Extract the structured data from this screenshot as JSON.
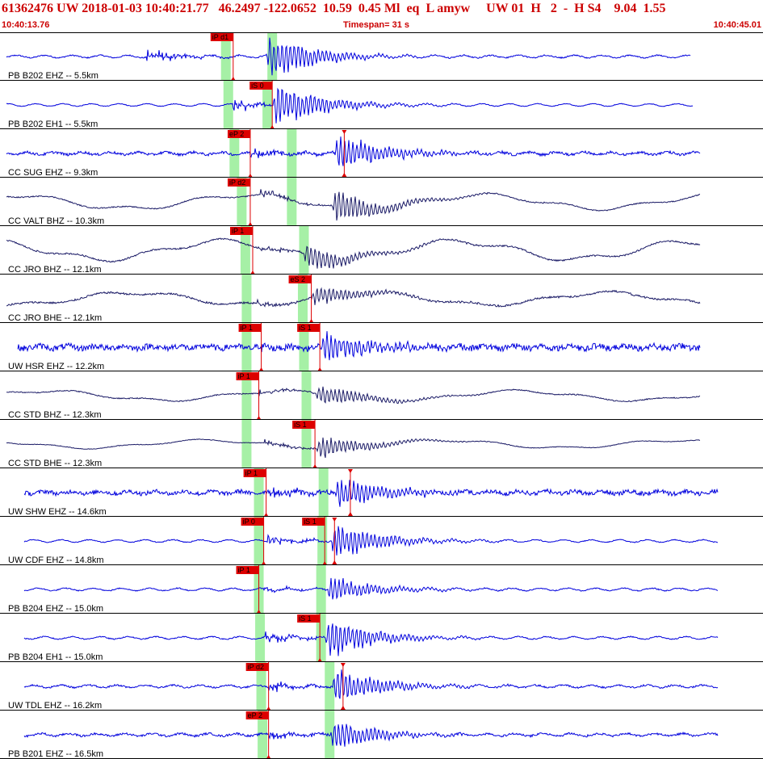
{
  "header": {
    "title": "61362476 UW 2018-01-03 10:40:21.77   46.2497 -122.0652  10.59  0.45 Ml  eq  L amyw     UW 01  H   2  -  H S4    9.04  1.55",
    "start_time": "10:40:13.76",
    "timespan": "Timespan=  31 s",
    "end_time": "10:40:45.01"
  },
  "colors": {
    "panel_border": "#000000",
    "trace_blue": "#0000dd",
    "trace_navy": "#1a1a66",
    "pick_red": "#dd0000",
    "window_green": "#a6f0a6",
    "header_red": "#cc0000"
  },
  "chart_data": {
    "type": "line",
    "x_range_s": [
      0,
      31.25
    ],
    "start_time": "10:40:13.76",
    "end_time": "10:40:45.01",
    "traces": [
      {
        "label": "PB B202 EHZ -- 5.5km",
        "color": "blue",
        "noise": 0.06,
        "lowfreq": 0.0,
        "p_time": 6.0,
        "s_time": 10.9,
        "amp": 1.0,
        "end": 28.3,
        "picks": [
          {
            "label": "iP d1",
            "t": 9.55
          }
        ],
        "green": [
          9.25,
          11.15
        ],
        "extra_marks": []
      },
      {
        "label": "PB B202 EH1 -- 5.5km",
        "color": "blue",
        "noise": 0.03,
        "lowfreq": 0.0,
        "p_time": 9.55,
        "s_time": 11.15,
        "amp": 1.0,
        "end": 28.4,
        "picks": [
          {
            "label": "iS 0",
            "t": 11.15
          }
        ],
        "green": [
          9.35,
          10.95
        ],
        "extra_marks": []
      },
      {
        "label": "CC SUG EHZ -- 9.3km",
        "color": "blue",
        "noise": 0.12,
        "lowfreq": 0.0,
        "p_time": 10.25,
        "s_time": 13.7,
        "amp": 0.9,
        "end": 28.7,
        "picks": [
          {
            "label": "eP 2",
            "t": 10.25
          }
        ],
        "green": [
          9.6,
          11.95
        ],
        "extra_marks": [
          14.1
        ]
      },
      {
        "label": "CC VALT BHZ -- 10.3km",
        "color": "navy",
        "noise": 0.05,
        "lowfreq": 0.32,
        "p_time": 10.65,
        "s_time": 13.6,
        "amp": 0.8,
        "end": 28.7,
        "picks": [
          {
            "label": "iP d2",
            "t": 10.25
          }
        ],
        "green": [
          9.9,
          11.95
        ],
        "extra_marks": []
      },
      {
        "label": "CC JRO BHZ -- 12.1km",
        "color": "navy",
        "noise": 0.07,
        "lowfreq": 0.42,
        "p_time": 10.5,
        "s_time": 12.4,
        "amp": 0.6,
        "end": 28.7,
        "picks": [
          {
            "label": "iP 1",
            "t": 10.35
          }
        ],
        "green": [
          10.05,
          12.45
        ],
        "extra_marks": []
      },
      {
        "label": "CC JRO BHE -- 12.1km",
        "color": "navy",
        "noise": 0.09,
        "lowfreq": 0.28,
        "p_time": 10.5,
        "s_time": 12.75,
        "amp": 0.45,
        "end": 28.7,
        "picks": [
          {
            "label": "eS 2",
            "t": 12.75
          }
        ],
        "green": [
          10.1,
          12.4
        ],
        "extra_marks": []
      },
      {
        "label": "UW HSR EHZ -- 12.2km",
        "color": "blue",
        "noise": 0.28,
        "lowfreq": 0.0,
        "p_time": 10.7,
        "s_time": 13.1,
        "amp": 0.75,
        "end": 28.7,
        "picks": [
          {
            "label": "iP 1",
            "t": 10.7
          },
          {
            "label": "iS 1",
            "t": 13.1
          }
        ],
        "green": [
          10.1,
          12.45
        ],
        "extra_marks": []
      },
      {
        "label": "CC STD BHZ -- 12.3km",
        "color": "navy",
        "noise": 0.05,
        "lowfreq": 0.22,
        "p_time": 10.6,
        "s_time": 12.9,
        "amp": 0.5,
        "end": 28.7,
        "picks": [
          {
            "label": "iP 1",
            "t": 10.6
          }
        ],
        "green": [
          10.1,
          12.55
        ],
        "extra_marks": []
      },
      {
        "label": "CC STD BHE -- 12.3km",
        "color": "navy",
        "noise": 0.03,
        "lowfreq": 0.18,
        "p_time": 10.8,
        "s_time": 12.95,
        "amp": 0.55,
        "end": 28.7,
        "picks": [
          {
            "label": "iS 1",
            "t": 12.9
          }
        ],
        "green": [
          10.1,
          12.55
        ],
        "extra_marks": []
      },
      {
        "label": "UW SHW EHZ -- 14.6km",
        "color": "blue",
        "noise": 0.2,
        "lowfreq": 0.0,
        "p_time": 11.05,
        "s_time": 13.7,
        "amp": 0.75,
        "end": 29.4,
        "picks": [
          {
            "label": "iP 1",
            "t": 10.9
          }
        ],
        "green": [
          10.6,
          13.25
        ],
        "extra_marks": [
          14.35
        ]
      },
      {
        "label": "UW CDF EHZ -- 14.8km",
        "color": "blue",
        "noise": 0.04,
        "lowfreq": 0.0,
        "p_time": 10.95,
        "s_time": 13.55,
        "amp": 0.9,
        "end": 29.4,
        "picks": [
          {
            "label": "iP 0",
            "t": 10.8
          },
          {
            "label": "iS 1",
            "t": 13.3
          }
        ],
        "green": [
          10.6,
          13.2
        ],
        "extra_marks": [
          13.7
        ]
      },
      {
        "label": "PB B204 EHZ -- 15.0km",
        "color": "blue",
        "noise": 0.05,
        "lowfreq": 0.0,
        "p_time": 10.75,
        "s_time": 13.4,
        "amp": 0.6,
        "end": 29.4,
        "picks": [
          {
            "label": "iP 1",
            "t": 10.6
          }
        ],
        "green": [
          10.6,
          13.15
        ],
        "extra_marks": []
      },
      {
        "label": "PB B204 EH1 -- 15.0km",
        "color": "blue",
        "noise": 0.05,
        "lowfreq": 0.0,
        "p_time": 10.85,
        "s_time": 13.3,
        "amp": 0.9,
        "end": 29.4,
        "picks": [
          {
            "label": "iS 1",
            "t": 13.1
          }
        ],
        "green": [
          10.65,
          13.15
        ],
        "extra_marks": []
      },
      {
        "label": "UW TDL EHZ -- 16.2km",
        "color": "blue",
        "noise": 0.08,
        "lowfreq": 0.0,
        "p_time": 11.0,
        "s_time": 13.6,
        "amp": 0.85,
        "end": 29.4,
        "picks": [
          {
            "label": "iP d2",
            "t": 11.0
          }
        ],
        "green": [
          10.7,
          13.5
        ],
        "extra_marks": [
          14.05
        ]
      },
      {
        "label": "PB B201 EHZ -- 16.5km",
        "color": "blue",
        "noise": 0.1,
        "lowfreq": 0.0,
        "p_time": 11.0,
        "s_time": 13.5,
        "amp": 0.7,
        "end": 29.4,
        "picks": [
          {
            "label": "eP 2",
            "t": 11.0
          }
        ],
        "green": [
          10.75,
          13.5
        ],
        "extra_marks": []
      }
    ]
  }
}
